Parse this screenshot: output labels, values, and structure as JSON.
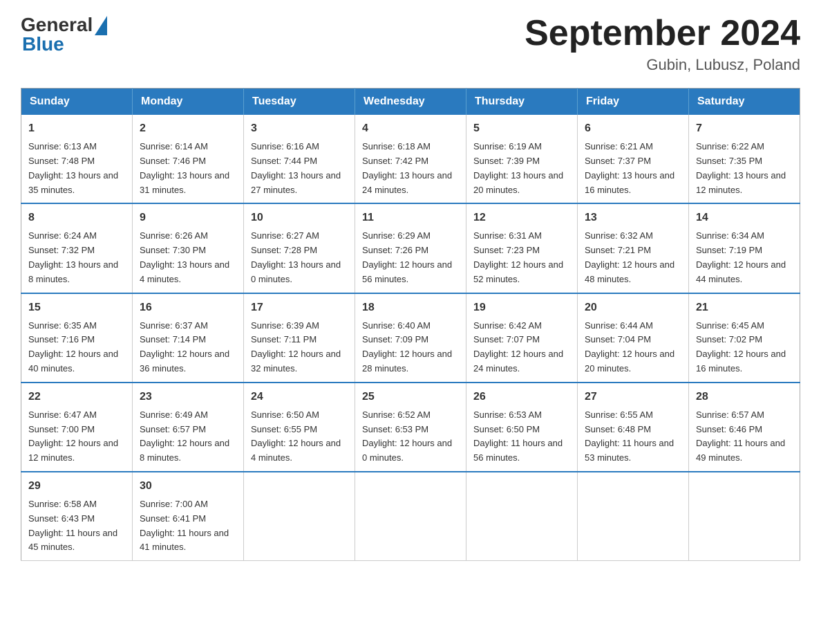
{
  "header": {
    "logo_general": "General",
    "logo_blue": "Blue",
    "main_title": "September 2024",
    "subtitle": "Gubin, Lubusz, Poland"
  },
  "calendar": {
    "headers": [
      "Sunday",
      "Monday",
      "Tuesday",
      "Wednesday",
      "Thursday",
      "Friday",
      "Saturday"
    ],
    "weeks": [
      [
        {
          "day": "1",
          "sunrise": "6:13 AM",
          "sunset": "7:48 PM",
          "daylight": "13 hours and 35 minutes."
        },
        {
          "day": "2",
          "sunrise": "6:14 AM",
          "sunset": "7:46 PM",
          "daylight": "13 hours and 31 minutes."
        },
        {
          "day": "3",
          "sunrise": "6:16 AM",
          "sunset": "7:44 PM",
          "daylight": "13 hours and 27 minutes."
        },
        {
          "day": "4",
          "sunrise": "6:18 AM",
          "sunset": "7:42 PM",
          "daylight": "13 hours and 24 minutes."
        },
        {
          "day": "5",
          "sunrise": "6:19 AM",
          "sunset": "7:39 PM",
          "daylight": "13 hours and 20 minutes."
        },
        {
          "day": "6",
          "sunrise": "6:21 AM",
          "sunset": "7:37 PM",
          "daylight": "13 hours and 16 minutes."
        },
        {
          "day": "7",
          "sunrise": "6:22 AM",
          "sunset": "7:35 PM",
          "daylight": "13 hours and 12 minutes."
        }
      ],
      [
        {
          "day": "8",
          "sunrise": "6:24 AM",
          "sunset": "7:32 PM",
          "daylight": "13 hours and 8 minutes."
        },
        {
          "day": "9",
          "sunrise": "6:26 AM",
          "sunset": "7:30 PM",
          "daylight": "13 hours and 4 minutes."
        },
        {
          "day": "10",
          "sunrise": "6:27 AM",
          "sunset": "7:28 PM",
          "daylight": "13 hours and 0 minutes."
        },
        {
          "day": "11",
          "sunrise": "6:29 AM",
          "sunset": "7:26 PM",
          "daylight": "12 hours and 56 minutes."
        },
        {
          "day": "12",
          "sunrise": "6:31 AM",
          "sunset": "7:23 PM",
          "daylight": "12 hours and 52 minutes."
        },
        {
          "day": "13",
          "sunrise": "6:32 AM",
          "sunset": "7:21 PM",
          "daylight": "12 hours and 48 minutes."
        },
        {
          "day": "14",
          "sunrise": "6:34 AM",
          "sunset": "7:19 PM",
          "daylight": "12 hours and 44 minutes."
        }
      ],
      [
        {
          "day": "15",
          "sunrise": "6:35 AM",
          "sunset": "7:16 PM",
          "daylight": "12 hours and 40 minutes."
        },
        {
          "day": "16",
          "sunrise": "6:37 AM",
          "sunset": "7:14 PM",
          "daylight": "12 hours and 36 minutes."
        },
        {
          "day": "17",
          "sunrise": "6:39 AM",
          "sunset": "7:11 PM",
          "daylight": "12 hours and 32 minutes."
        },
        {
          "day": "18",
          "sunrise": "6:40 AM",
          "sunset": "7:09 PM",
          "daylight": "12 hours and 28 minutes."
        },
        {
          "day": "19",
          "sunrise": "6:42 AM",
          "sunset": "7:07 PM",
          "daylight": "12 hours and 24 minutes."
        },
        {
          "day": "20",
          "sunrise": "6:44 AM",
          "sunset": "7:04 PM",
          "daylight": "12 hours and 20 minutes."
        },
        {
          "day": "21",
          "sunrise": "6:45 AM",
          "sunset": "7:02 PM",
          "daylight": "12 hours and 16 minutes."
        }
      ],
      [
        {
          "day": "22",
          "sunrise": "6:47 AM",
          "sunset": "7:00 PM",
          "daylight": "12 hours and 12 minutes."
        },
        {
          "day": "23",
          "sunrise": "6:49 AM",
          "sunset": "6:57 PM",
          "daylight": "12 hours and 8 minutes."
        },
        {
          "day": "24",
          "sunrise": "6:50 AM",
          "sunset": "6:55 PM",
          "daylight": "12 hours and 4 minutes."
        },
        {
          "day": "25",
          "sunrise": "6:52 AM",
          "sunset": "6:53 PM",
          "daylight": "12 hours and 0 minutes."
        },
        {
          "day": "26",
          "sunrise": "6:53 AM",
          "sunset": "6:50 PM",
          "daylight": "11 hours and 56 minutes."
        },
        {
          "day": "27",
          "sunrise": "6:55 AM",
          "sunset": "6:48 PM",
          "daylight": "11 hours and 53 minutes."
        },
        {
          "day": "28",
          "sunrise": "6:57 AM",
          "sunset": "6:46 PM",
          "daylight": "11 hours and 49 minutes."
        }
      ],
      [
        {
          "day": "29",
          "sunrise": "6:58 AM",
          "sunset": "6:43 PM",
          "daylight": "11 hours and 45 minutes."
        },
        {
          "day": "30",
          "sunrise": "7:00 AM",
          "sunset": "6:41 PM",
          "daylight": "11 hours and 41 minutes."
        },
        null,
        null,
        null,
        null,
        null
      ]
    ]
  }
}
